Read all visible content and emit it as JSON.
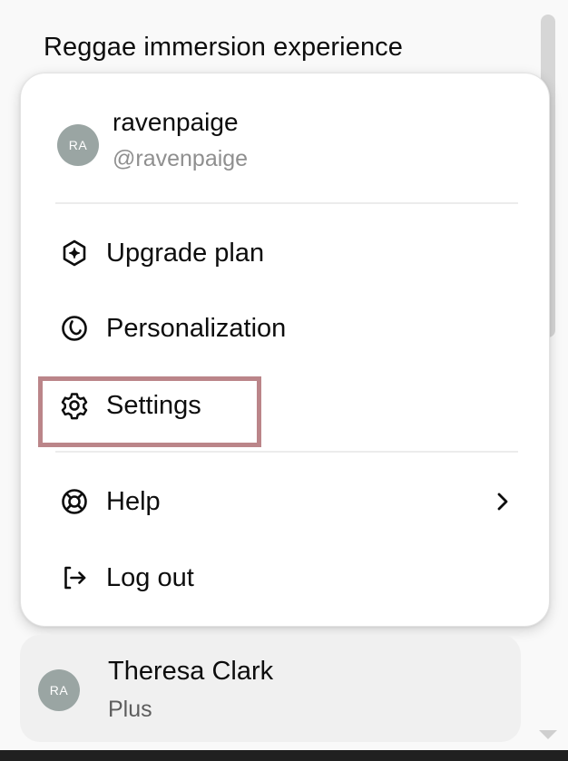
{
  "background": {
    "conversation_title": "Reggae immersion experience"
  },
  "menu": {
    "profile": {
      "avatar_initials": "RA",
      "name": "ravenpaige",
      "handle": "@ravenpaige"
    },
    "items": [
      {
        "label": "Upgrade plan",
        "icon": "upgrade-sparkle-icon"
      },
      {
        "label": "Personalization",
        "icon": "personalization-icon"
      },
      {
        "label": "Settings",
        "icon": "gear-icon"
      },
      {
        "label": "Help",
        "icon": "lifebuoy-icon",
        "has_submenu": true
      },
      {
        "label": "Log out",
        "icon": "logout-icon"
      }
    ]
  },
  "account": {
    "avatar_initials": "RA",
    "name": "Theresa Clark",
    "plan": "Plus"
  },
  "colors": {
    "highlight": "#bb8589",
    "avatar": "#9aa5a3"
  }
}
